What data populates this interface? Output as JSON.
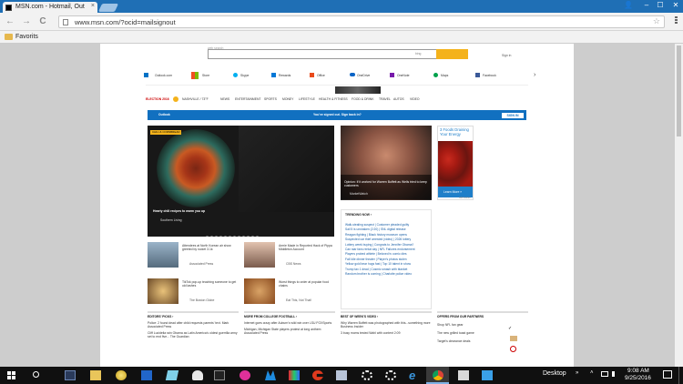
{
  "browser": {
    "tab_title": "MSN.com - Hotmail, Out",
    "tab_close": "×",
    "url": "www.msn.com/?ocid=mailsignout",
    "bookmark_folder": "Favorits",
    "window_min": "–",
    "window_max": "☐",
    "window_close": "✕",
    "nav_back": "←",
    "nav_forward": "→",
    "nav_reload": "C"
  },
  "msn": {
    "search_bing": "bing",
    "search_web_label": "web search",
    "sign_in": "Sign in",
    "apps": [
      "Outlook.com",
      "Store",
      "Skype",
      "Rewards",
      "Office",
      "OneDrive",
      "OneNote",
      "Maps",
      "Facebook"
    ],
    "nav": {
      "election": "ELECTION 2016",
      "weather": "NASHVILLE / 73°F",
      "items": [
        "NEWS",
        "ENTERTAINMENT",
        "SPORTS",
        "MONEY",
        "LIFESTYLE",
        "HEALTH & FITNESS",
        "FOOD & DRINK",
        "TRAVEL",
        "AUTOS",
        "VIDEO"
      ]
    },
    "banner": {
      "label": "Outlook",
      "message": "You've signed out. Sign back in?",
      "button": "SIGN IN"
    },
    "hero": {
      "badge": "CHILI & CORNBREAD",
      "headline": "Hearty chili recipes to warm you up",
      "source": "Southern Living"
    },
    "feature": {
      "headline": "Opinion: If it worked for Warren Buffett as Wells tried to keep customers",
      "source": "MarketWatch"
    },
    "ad": {
      "headline": "3 Foods Draining Your Energy",
      "button": "Learn More »",
      "label": "AdChoices"
    },
    "trending": {
      "title": "TRENDING NOW ›",
      "items": [
        "Walk-stealing suspect | Customer pleaded guilty",
        "Sail 5 is unshaken (2:20) | SNL digital release",
        "Reagan fighting | Black history museum opens",
        "Suspected car thief arrested (video) | 2026 lottery",
        "Lottery week buying | Congrats to Jennifer Obama?",
        "Can star fans rental day | NFL Failures endorsement",
        "Players probed athlete | Beloved tv comic dies",
        "Fall Idle dinner theater | Player's photos stolen",
        "Yellow gold bear hugs fast | Top 10 talent in show",
        "Trump tax 1 dead | Cosmic smash with blanket",
        "Random brother is coming | Charlotte police video"
      ]
    },
    "cards": [
      {
        "title": "Attendees at North Korean air show greeted by rocket 3.1k",
        "source": "Associated Press"
      },
      {
        "title": "Armie Made in Reported Hack of Pippa Middleton Account",
        "source": "CBS News"
      },
      {
        "title": "TikTok pop-up teaching someone to get old lashes",
        "source": "The Boston Globe"
      },
      {
        "title": "Worst things to order at popular food chains",
        "source": "Eat This, Not That!"
      }
    ],
    "sections": [
      {
        "title": "EDITORS' PICKS ›",
        "lines": [
          "Police: 2 found dead after child requests parents' text. Mark Associated Press",
          "Cliff Lucidelia rain Obama as Latin America's oldest guerrilla army set to end five... The Guardian"
        ]
      },
      {
        "title": "MORE FROM COLLEGE FOOTBALL ›",
        "lines": [
          "Internet goes crazy after Auburn's wild win over LSU FOXSports",
          "Michigan, Michigan State players protest at long anthem Associated Press"
        ]
      },
      {
        "title": "BEST OF WEEK'S VIDEO ›",
        "lines": [
          "Why Warren Buffett was photographed with this...something more Business Insider",
          "3 busy moms tested Wahl with content 2:09"
        ]
      },
      {
        "title": "OFFERS FROM OUR PARTNERS",
        "lines": [
          "Shop NFL fan gear",
          "The new grilled toast game",
          "Target's clearance deals"
        ]
      }
    ]
  },
  "taskbar": {
    "desktop_label": "Desktop",
    "time": "9:08 AM",
    "date": "9/25/2016"
  },
  "colors": {
    "chrome_blue": "#1f6fb5",
    "msn_blue": "#1170c0",
    "bing_orange": "#f4b21b",
    "taskbar": "#101010"
  }
}
